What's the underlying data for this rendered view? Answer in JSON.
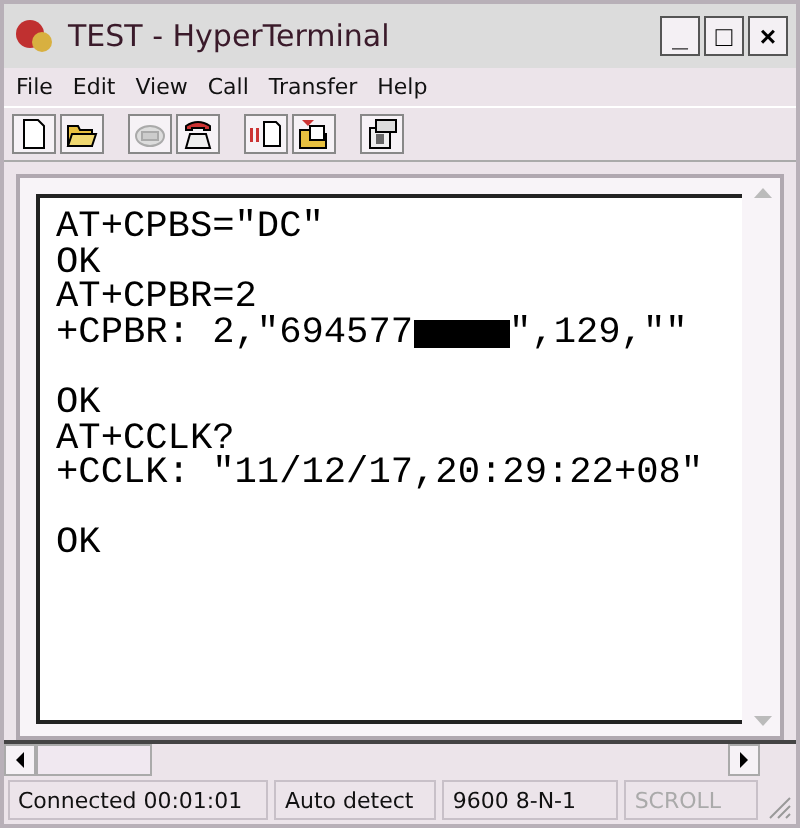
{
  "window": {
    "title": "TEST - HyperTerminal",
    "controls": [
      "_",
      "□",
      "×"
    ]
  },
  "menu": [
    {
      "label": "File",
      "disabled": false
    },
    {
      "label": "Edit",
      "disabled": false
    },
    {
      "label": "View",
      "disabled": false
    },
    {
      "label": "Call",
      "disabled": false
    },
    {
      "label": "Transfer",
      "disabled": false
    },
    {
      "label": "Help",
      "disabled": false
    }
  ],
  "toolbar": [
    {
      "kind": "new",
      "disabled": false
    },
    {
      "kind": "open",
      "disabled": false
    },
    {
      "kind": "sep"
    },
    {
      "kind": "phone",
      "disabled": true
    },
    {
      "kind": "hangup",
      "disabled": false
    },
    {
      "kind": "sep"
    },
    {
      "kind": "send",
      "disabled": false
    },
    {
      "kind": "receive",
      "disabled": false
    },
    {
      "kind": "sep"
    },
    {
      "kind": "properties",
      "disabled": false
    }
  ],
  "terminal": [
    {
      "kind": "text",
      "text": "AT+CPBS=\"DC\""
    },
    {
      "kind": "text",
      "text": "OK"
    },
    {
      "kind": "text",
      "text": "AT+CPBR=2"
    },
    {
      "kind": "redacted",
      "before": "+CPBR: 2,\"694577",
      "after": "\",129,\"\""
    },
    {
      "kind": "blank"
    },
    {
      "kind": "text",
      "text": "OK"
    },
    {
      "kind": "text",
      "text": "AT+CCLK?"
    },
    {
      "kind": "text",
      "text": "+CCLK: \"11/12/17,20:29:22+08\""
    },
    {
      "kind": "blank"
    },
    {
      "kind": "text",
      "text": "OK"
    }
  ],
  "status_bar": [
    {
      "text": "Connected 00:01:01",
      "disabled": false
    },
    {
      "text": "Auto detect",
      "disabled": false
    },
    {
      "text": "9600 8-N-1",
      "disabled": false
    },
    {
      "text": "SCROLL",
      "disabled": true
    }
  ]
}
